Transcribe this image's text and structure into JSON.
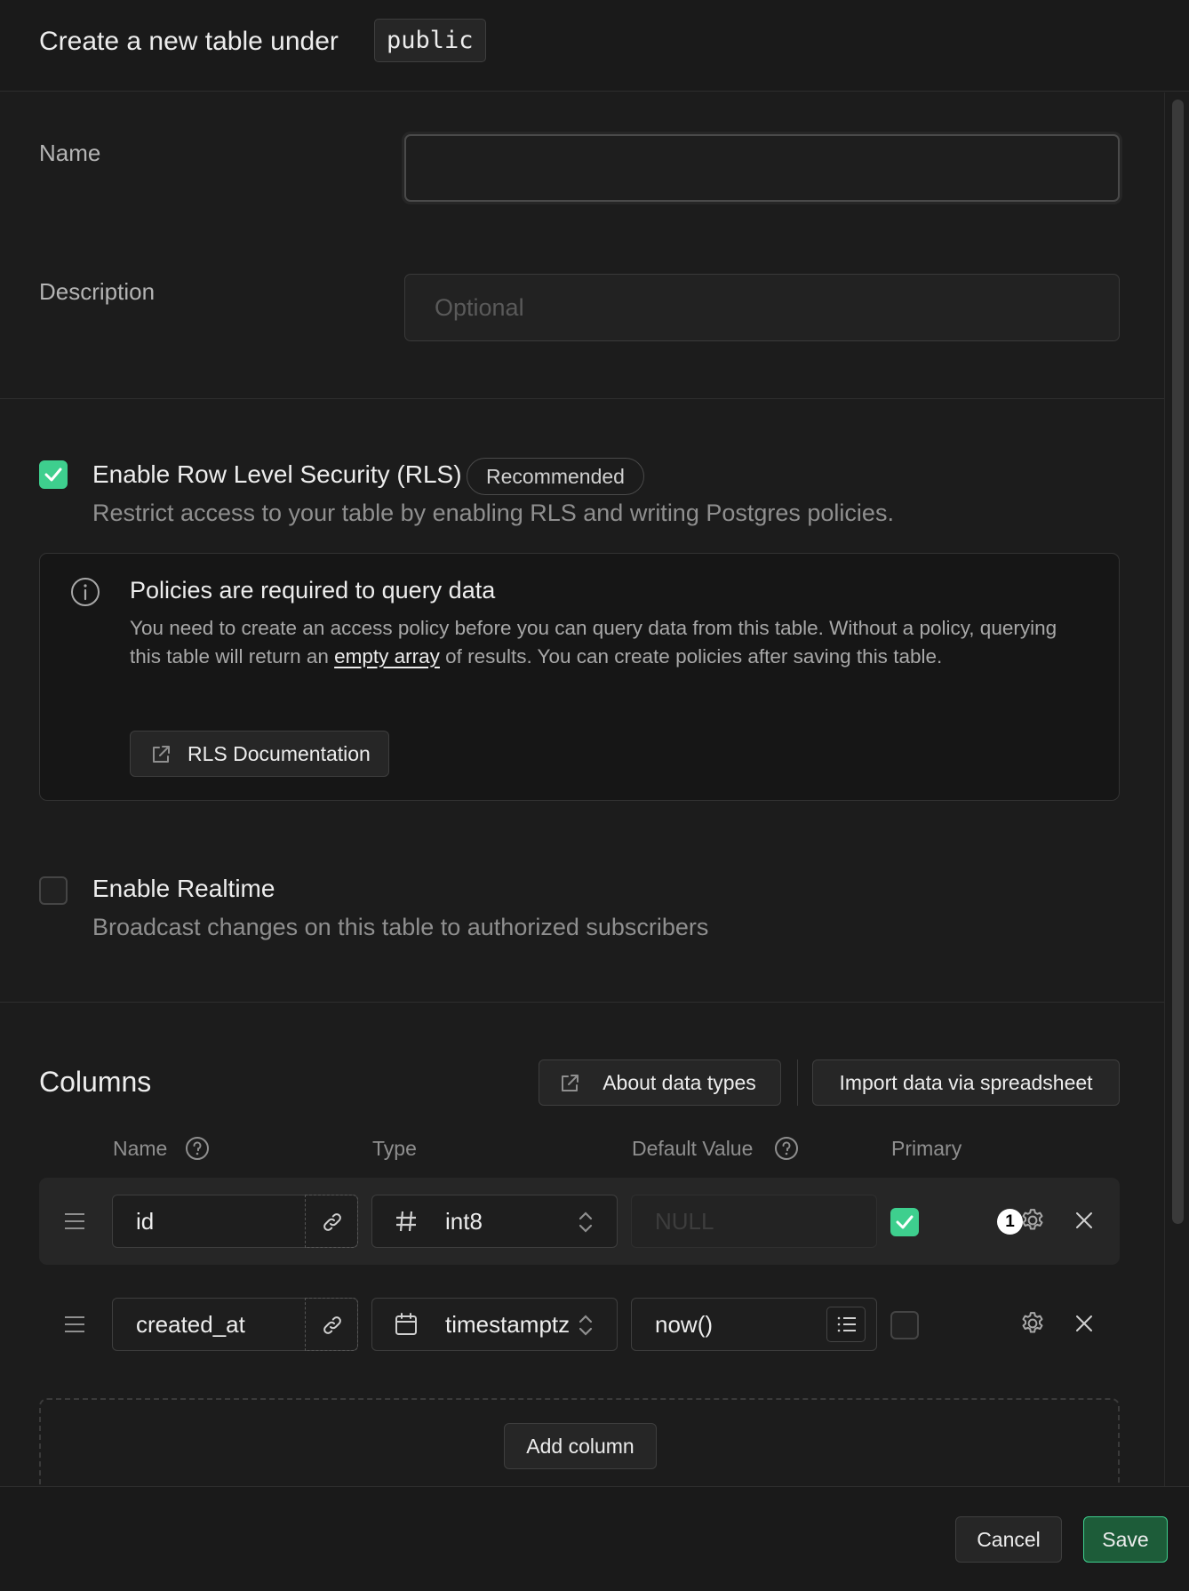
{
  "header": {
    "title": "Create a new table under",
    "schema": "public"
  },
  "form": {
    "name": {
      "label": "Name",
      "value": "",
      "placeholder": ""
    },
    "description": {
      "label": "Description",
      "value": "",
      "placeholder": "Optional"
    }
  },
  "rls": {
    "checked": true,
    "title": "Enable Row Level Security (RLS)",
    "badge": "Recommended",
    "description": "Restrict access to your table by enabling RLS and writing Postgres policies.",
    "callout": {
      "title": "Policies are required to query data",
      "body_before": "You need to create an access policy before you can query data from this table. Without a policy, querying this table will return an ",
      "body_link": "empty array",
      "body_after": " of results. You can create policies after saving this table.",
      "button": "RLS Documentation"
    }
  },
  "realtime": {
    "checked": false,
    "title": "Enable Realtime",
    "description": "Broadcast changes on this table to authorized subscribers"
  },
  "columns": {
    "title": "Columns",
    "about_button": "About data types",
    "import_button": "Import data via spreadsheet",
    "headers": {
      "name": "Name",
      "type": "Type",
      "default": "Default Value",
      "primary": "Primary"
    },
    "rows": [
      {
        "name": "id",
        "type": "int8",
        "type_icon": "hash-icon",
        "default": "",
        "default_placeholder": "NULL",
        "primary": true,
        "settings_count": "1"
      },
      {
        "name": "created_at",
        "type": "timestamptz",
        "type_icon": "calendar-icon",
        "default": "now()",
        "default_placeholder": "",
        "primary": false,
        "settings_count": ""
      }
    ],
    "add_button": "Add column"
  },
  "footer": {
    "cancel": "Cancel",
    "save": "Save"
  },
  "colors": {
    "accent": "#3ecf8e",
    "save_bg": "#1d5c39",
    "background": "#1c1c1c"
  }
}
